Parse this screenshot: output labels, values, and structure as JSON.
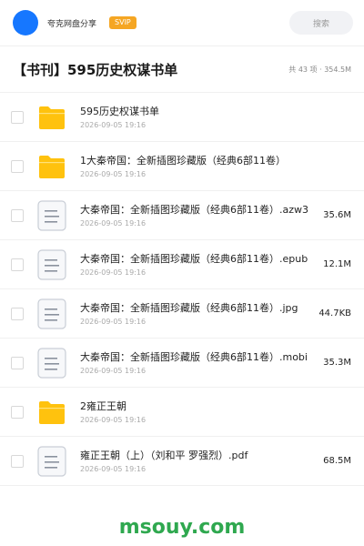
{
  "header": {
    "share_label": "夸克网盘分享",
    "svip_badge": "SVIP",
    "search_placeholder": "搜索"
  },
  "title_row": {
    "title": "【书刊】595历史权谋书单",
    "summary": "共 43 项 · 354.5M"
  },
  "colors": {
    "avatar": "#1677ff",
    "svip": "#f5a623",
    "folder": "#ffc20e",
    "watermark": "#2fa84f"
  },
  "files": [
    {
      "type": "folder-icon",
      "name": "595历史权谋书单",
      "date": "2026-09-05 19:16",
      "size": ""
    },
    {
      "type": "folder-icon",
      "name": "1大秦帝国：全新插图珍藏版（经典6部11卷）",
      "date": "2026-09-05 19:16",
      "size": ""
    },
    {
      "type": "document-icon",
      "name": "大秦帝国：全新插图珍藏版（经典6部11卷）.azw3",
      "date": "2026-09-05 19:16",
      "size": "35.6M"
    },
    {
      "type": "document-icon",
      "name": "大秦帝国：全新插图珍藏版（经典6部11卷）.epub",
      "date": "2026-09-05 19:16",
      "size": "12.1M"
    },
    {
      "type": "document-icon",
      "name": "大秦帝国：全新插图珍藏版（经典6部11卷）.jpg",
      "date": "2026-09-05 19:16",
      "size": "44.7KB"
    },
    {
      "type": "document-icon",
      "name": "大秦帝国：全新插图珍藏版（经典6部11卷）.mobi",
      "date": "2026-09-05 19:16",
      "size": "35.3M"
    },
    {
      "type": "folder-icon",
      "name": "2雍正王朝",
      "date": "2026-09-05 19:16",
      "size": ""
    },
    {
      "type": "document-icon",
      "name": "雍正王朝（上）（刘和平 罗强烈）.pdf",
      "date": "2026-09-05 19:16",
      "size": "68.5M"
    }
  ],
  "watermark": "msouy.com"
}
